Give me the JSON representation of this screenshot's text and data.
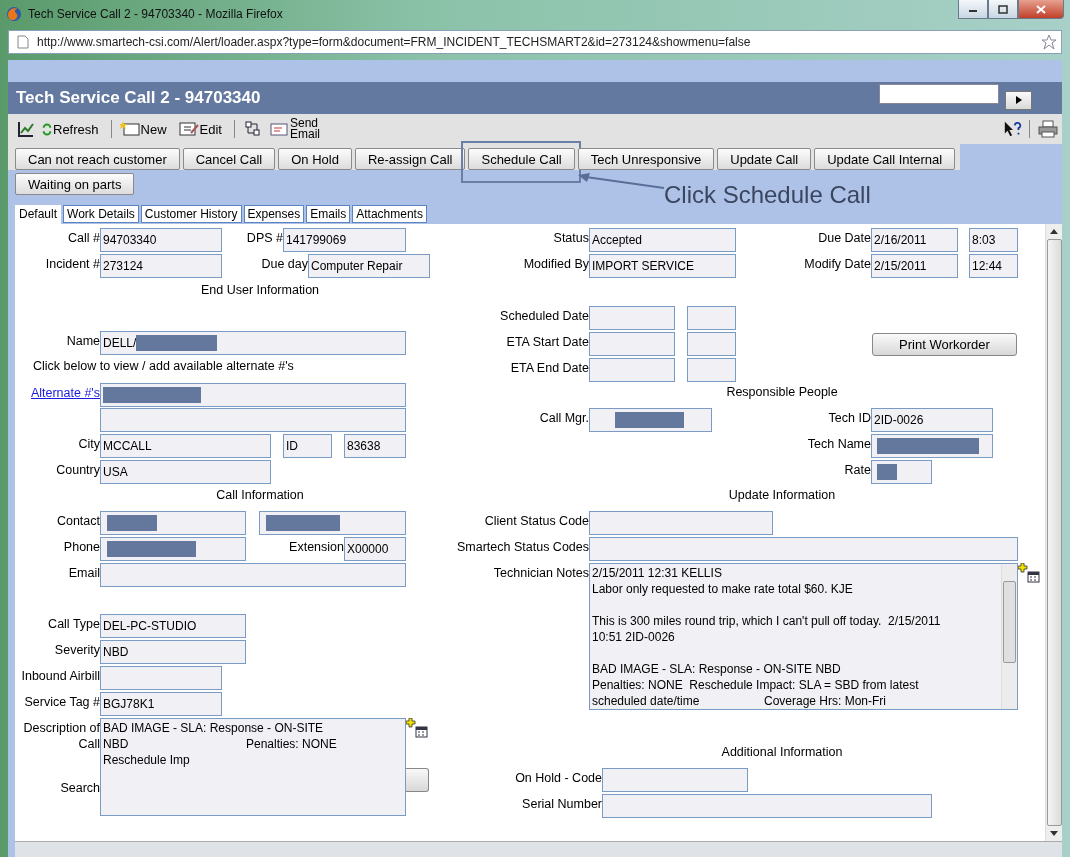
{
  "browser": {
    "title": "Tech Service Call 2 - 94703340 - Mozilla Firefox",
    "url": "http://www.smartech-csi.com/Alert/loader.aspx?type=form&document=FRM_INCIDENT_TECHSMART2&id=273124&showmenu=false"
  },
  "page_title": "Tech Service Call 2 - 94703340",
  "toolbar": [
    "Refresh",
    "New",
    "Edit",
    "Send Email"
  ],
  "actions": [
    {
      "label": "Can not reach customer",
      "annotated": false
    },
    {
      "label": "Cancel Call",
      "annotated": false
    },
    {
      "label": "On Hold",
      "annotated": false
    },
    {
      "label": "Re-assign Call",
      "annotated": false
    },
    {
      "label": "Schedule Call",
      "annotated": true
    },
    {
      "label": "Tech Unresponsive",
      "annotated": false
    },
    {
      "label": "Update Call",
      "annotated": false
    },
    {
      "label": "Update Call Internal",
      "annotated": false
    },
    {
      "label": "Waiting on parts",
      "annotated": false
    }
  ],
  "annotation": "Click Schedule Call",
  "tabs": [
    {
      "label": "Default",
      "selected": true
    },
    {
      "label": "Work Details",
      "selected": false
    },
    {
      "label": "Customer History",
      "selected": false
    },
    {
      "label": "Expenses",
      "selected": false
    },
    {
      "label": "Emails",
      "selected": false
    },
    {
      "label": "Attachments",
      "selected": false
    }
  ],
  "left": [
    {
      "kind": "fields",
      "cells": [
        {
          "kind": "text",
          "label": "Call #",
          "value": "94703340"
        },
        {
          "kind": "text",
          "label": "DPS #",
          "value": "141799069"
        }
      ]
    },
    {
      "kind": "fields",
      "cells": [
        {
          "kind": "text",
          "label": "Incident #",
          "value": "273124"
        },
        {
          "kind": "text",
          "label": "Due day",
          "value": "Computer Repair"
        }
      ]
    },
    {
      "kind": "heading",
      "text": "End User Information"
    },
    {
      "kind": "fields",
      "cells": [
        {
          "kind": "text",
          "label": "Name",
          "value": "DELL/",
          "redacted": true
        }
      ]
    },
    {
      "kind": "note",
      "text": "Click below to view / add available alternate #'s"
    },
    {
      "kind": "fields",
      "cells": [
        {
          "kind": "text",
          "label": "Alternate #'s",
          "label_is_link": true,
          "redacted": true
        }
      ]
    },
    {
      "kind": "fields",
      "cells": [
        {
          "kind": "text"
        }
      ]
    },
    {
      "kind": "fields",
      "cells": [
        {
          "kind": "text",
          "label": "City",
          "value": "MCCALL"
        },
        {
          "kind": "text",
          "value": "ID"
        },
        {
          "kind": "text",
          "value": "83638"
        }
      ]
    },
    {
      "kind": "fields",
      "cells": [
        {
          "kind": "text",
          "label": "Country",
          "value": "USA"
        }
      ]
    },
    {
      "kind": "heading",
      "text": "Call Information"
    },
    {
      "kind": "fields",
      "cells": [
        {
          "kind": "text",
          "label": "Contact",
          "redacted": true
        },
        {
          "kind": "text",
          "redacted": true
        }
      ]
    },
    {
      "kind": "fields",
      "cells": [
        {
          "kind": "text",
          "label": "Phone",
          "redacted": true
        },
        {
          "kind": "text",
          "label": "Extension",
          "value": "X00000"
        }
      ]
    },
    {
      "kind": "fields",
      "cells": [
        {
          "kind": "text",
          "label": "Email"
        }
      ]
    },
    {
      "kind": "fields",
      "cells": [
        {
          "kind": "text",
          "label": "Call Type",
          "value": "DEL-PC-STUDIO"
        }
      ]
    },
    {
      "kind": "fields",
      "cells": [
        {
          "kind": "text",
          "label": "Severity",
          "value": "NBD"
        }
      ]
    },
    {
      "kind": "fields",
      "cells": [
        {
          "kind": "text",
          "label": "Inbound Airbill"
        }
      ]
    },
    {
      "kind": "fields",
      "cells": [
        {
          "kind": "text",
          "label": "Service Tag #",
          "value": "BGJ78K1"
        }
      ]
    },
    {
      "kind": "fields",
      "cells": [
        {
          "kind": "textarea",
          "label": "Description of Call",
          "sub_label": "Search",
          "paragraphs": [
            [
              [
                "BAD IMAGE - SLA: Response - ON-SITE"
              ],
              [
                "NBD",
                "Penalties: NONE"
              ],
              [
                "Reschedule Imp"
              ]
            ]
          ]
        }
      ]
    }
  ],
  "right": [
    {
      "kind": "fields",
      "cells": [
        {
          "kind": "text",
          "label": "Status",
          "value": "Accepted"
        },
        {
          "kind": "text",
          "label": "Due Date",
          "value": "2/16/2011"
        },
        {
          "kind": "text",
          "value": "8:03"
        }
      ]
    },
    {
      "kind": "fields",
      "cells": [
        {
          "kind": "text",
          "label": "Modified By",
          "value": "IMPORT SERVICE"
        },
        {
          "kind": "text",
          "label": "Modify Date",
          "value": "2/15/2011"
        },
        {
          "kind": "text",
          "value": "12:44"
        }
      ]
    },
    {
      "kind": "fields",
      "cells": [
        {
          "kind": "text",
          "label": "Scheduled Date"
        },
        {
          "kind": "text"
        }
      ]
    },
    {
      "kind": "fields",
      "cells": [
        {
          "kind": "text",
          "label": "ETA Start Date"
        },
        {
          "kind": "text"
        },
        {
          "kind": "button",
          "label": "Print Workorder"
        }
      ]
    },
    {
      "kind": "fields",
      "cells": [
        {
          "kind": "text",
          "label": "ETA End Date"
        },
        {
          "kind": "text"
        }
      ]
    },
    {
      "kind": "heading",
      "text": "Responsible People"
    },
    {
      "kind": "fields",
      "cells": [
        {
          "kind": "text",
          "label": "Call Mgr.",
          "redacted": true
        },
        {
          "kind": "text",
          "label": "Tech ID",
          "value": "2ID-0026"
        }
      ]
    },
    {
      "kind": "fields",
      "cells": [
        {
          "kind": "text",
          "label": "Tech Name",
          "redacted": true
        }
      ]
    },
    {
      "kind": "fields",
      "cells": [
        {
          "kind": "text",
          "label": "Rate",
          "redacted": true
        }
      ]
    },
    {
      "kind": "heading",
      "text": "Update Information"
    },
    {
      "kind": "fields",
      "cells": [
        {
          "kind": "text",
          "label": "Client Status Code"
        }
      ]
    },
    {
      "kind": "fields",
      "cells": [
        {
          "kind": "text",
          "label": "Smartech Status Codes"
        }
      ]
    },
    {
      "kind": "fields",
      "cells": [
        {
          "kind": "textarea",
          "label": "Technician Notes",
          "paragraphs": [
            [
              [
                "2/15/2011 12:31 KELLIS"
              ],
              [
                "Labor only requested to make rate total $60. KJE"
              ]
            ],
            [
              [
                "This is 300 miles round trip, which I can't pull off today.  2/15/2011"
              ],
              [
                "10:51 2ID-0026"
              ]
            ],
            [
              [
                "BAD IMAGE - SLA: Response - ON-SITE NBD"
              ],
              [
                "Penalties: NONE  Reschedule Impact: SLA = SBD from latest"
              ],
              [
                "scheduled date/time",
                "Coverage Hrs: Mon-Fri"
              ]
            ]
          ]
        }
      ]
    },
    {
      "kind": "heading",
      "text": "Additional Information"
    },
    {
      "kind": "fields",
      "cells": [
        {
          "kind": "text",
          "label": "On Hold - Code"
        }
      ]
    },
    {
      "kind": "fields",
      "cells": [
        {
          "kind": "text",
          "label": "Serial Number"
        }
      ]
    }
  ]
}
